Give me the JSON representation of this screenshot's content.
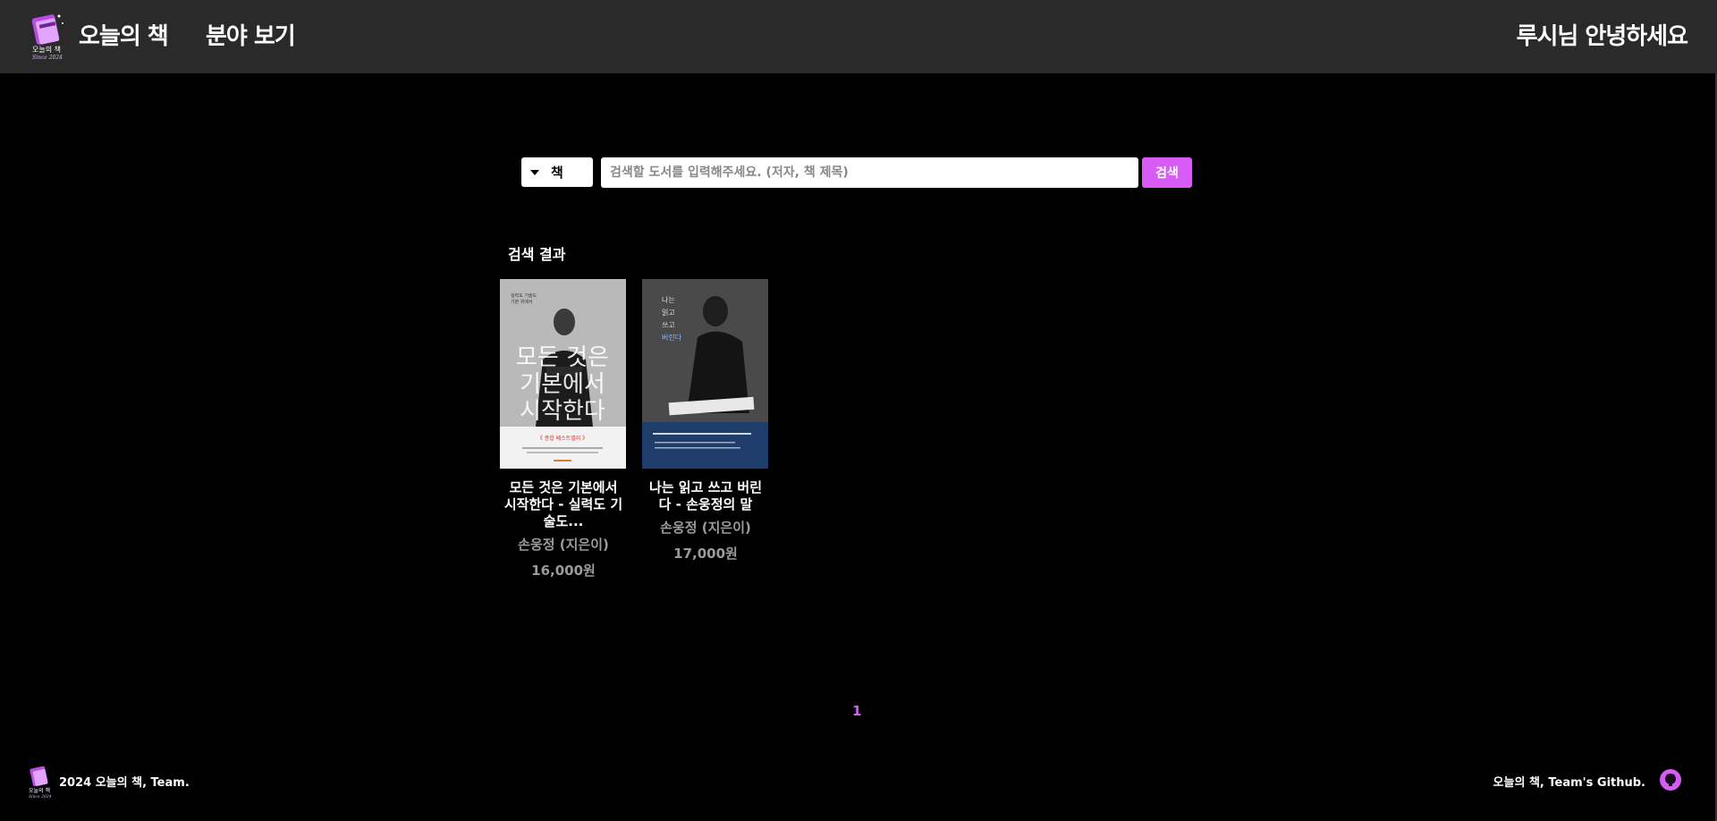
{
  "header": {
    "logo_alt": "오늘의 책 Since 2024",
    "nav_home": "오늘의 책",
    "nav_genre": "분야 보기",
    "greeting": "루시님 안녕하세요"
  },
  "search": {
    "type_selected": "책",
    "placeholder": "검색할 도서를 입력해주세요. (저자, 책 제목)",
    "button_label": "검색"
  },
  "results": {
    "title": "검색 결과",
    "books": [
      {
        "title": "모든 것은 기본에서 시작한다 - 실력도 기술도...",
        "author": "손웅정 (지은이)",
        "price": "16,000원",
        "cover_text": "모든 것은 기본에서 시작한다"
      },
      {
        "title": "나는 읽고 쓰고 버린다 - 손웅정의 말",
        "author": "손웅정 (지은이)",
        "price": "17,000원",
        "cover_text": "나는 읽고 쓰고 버린다"
      }
    ]
  },
  "pagination": {
    "current": "1"
  },
  "footer": {
    "left_text": "2024 오늘의 책, Team.",
    "right_text": "오늘의 책, Team's Github."
  },
  "colors": {
    "accent": "#d65cf5",
    "header_bg": "#2a2a2a",
    "page_bg": "#000000",
    "muted_text": "#9b9b9b"
  }
}
